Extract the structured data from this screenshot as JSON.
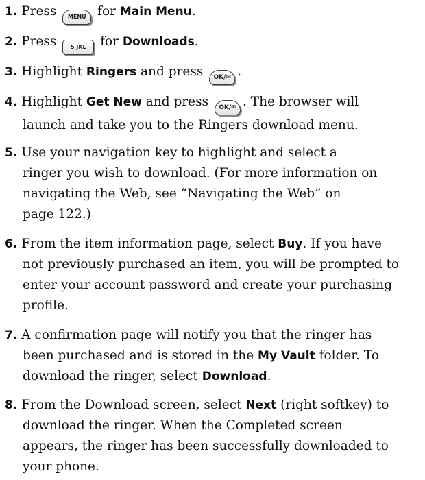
{
  "steps": [
    {
      "num": "1.",
      "lines": [
        [
          {
            "t": "Press "
          },
          {
            "key": "MENU",
            "keyclass": "key-menu",
            "name": "menu-key-icon"
          },
          {
            "t": " for "
          },
          {
            "b": "Main Menu"
          },
          {
            "t": "."
          }
        ]
      ]
    },
    {
      "num": "2.",
      "lines": [
        [
          {
            "t": "Press "
          },
          {
            "key": "5 JKL",
            "keyclass": "key-five",
            "name": "five-jkl-key-icon"
          },
          {
            "t": " for "
          },
          {
            "b": "Downloads"
          },
          {
            "t": "."
          }
        ]
      ]
    },
    {
      "num": "3.",
      "lines": [
        [
          {
            "t": "Highlight "
          },
          {
            "b": "Ringers"
          },
          {
            "t": " and press "
          },
          {
            "key": "OK/✉",
            "keyclass": "key-ok",
            "name": "ok-key-icon"
          },
          {
            "t": "."
          }
        ]
      ]
    },
    {
      "num": "4.",
      "lines": [
        [
          {
            "t": "Highlight "
          },
          {
            "b": "Get New"
          },
          {
            "t": " and press "
          },
          {
            "key": "OK/✉",
            "keyclass": "key-ok",
            "name": "ok-key-icon"
          },
          {
            "t": ". The browser will"
          }
        ],
        [
          {
            "t": "launch and take you to the Ringers download menu."
          }
        ]
      ]
    },
    {
      "num": "5.",
      "lines": [
        [
          {
            "t": "Use your navigation key to highlight and select a"
          }
        ],
        [
          {
            "t": "ringer you wish to download. (For more information on"
          }
        ],
        [
          {
            "t": "navigating the Web, see “Navigating the Web” on"
          }
        ],
        [
          {
            "t": "page 122.)"
          }
        ]
      ]
    },
    {
      "num": "6.",
      "lines": [
        [
          {
            "t": "From the item information page, select "
          },
          {
            "b": "Buy"
          },
          {
            "t": ". If you have"
          }
        ],
        [
          {
            "t": "not previously purchased an item, you will be prompted to"
          }
        ],
        [
          {
            "t": "enter your account password and create your purchasing"
          }
        ],
        [
          {
            "t": "profile."
          }
        ]
      ]
    },
    {
      "num": "7.",
      "lines": [
        [
          {
            "t": "A confirmation page will notify you that the ringer has"
          }
        ],
        [
          {
            "t": "been purchased and is stored in the "
          },
          {
            "b": "My Vault"
          },
          {
            "t": " folder. To"
          }
        ],
        [
          {
            "t": "download the ringer, select "
          },
          {
            "b": "Download"
          },
          {
            "t": "."
          }
        ]
      ]
    },
    {
      "num": "8.",
      "lines": [
        [
          {
            "t": "From the Download screen, select "
          },
          {
            "b": "Next"
          },
          {
            "t": " (right softkey) to"
          }
        ],
        [
          {
            "t": "download the ringer. When the Completed screen"
          }
        ],
        [
          {
            "t": "appears, the ringer has been successfully downloaded to"
          }
        ],
        [
          {
            "t": "your phone."
          }
        ]
      ]
    }
  ]
}
